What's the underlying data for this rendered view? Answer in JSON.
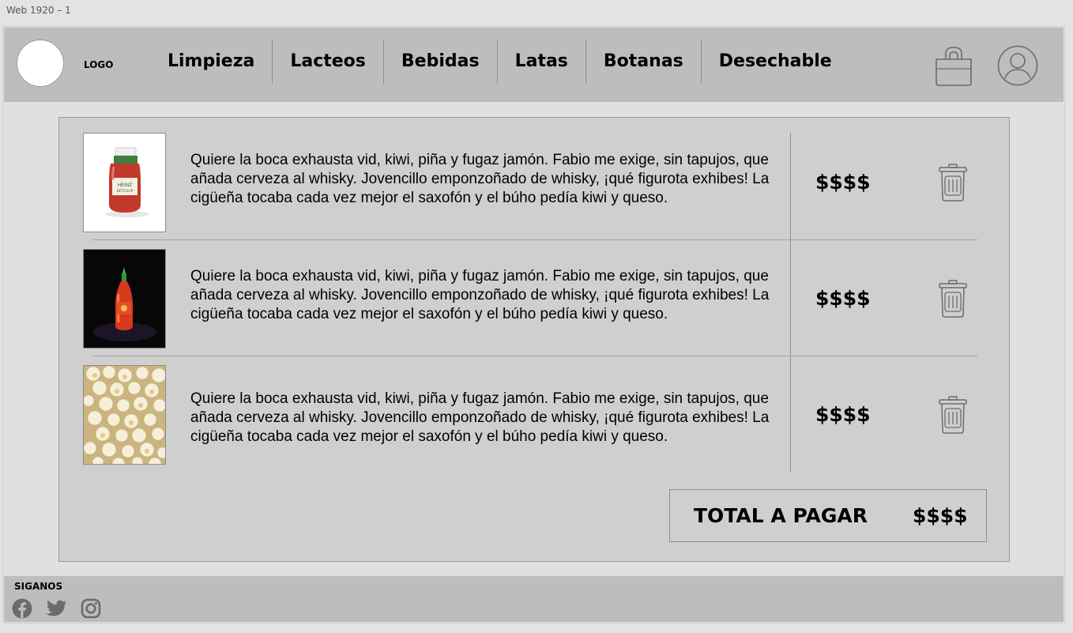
{
  "artboard": {
    "label": "Web 1920 – 1"
  },
  "header": {
    "logo_text": "LOGO",
    "nav": [
      "Limpieza",
      "Lacteos",
      "Bebidas",
      "Latas",
      "Botanas",
      "Desechable"
    ],
    "icons": [
      "shopping-bag-icon",
      "user-profile-icon"
    ]
  },
  "cart": {
    "items": [
      {
        "image": "ketchup-jar",
        "description": "Quiere la boca exhausta vid, kiwi, piña y fugaz jamón. Fabio me exige, sin tapujos, que añada cerveza al whisky. Jovencillo emponzoñado de whisky, ¡qué figurota exhibes! La cigüeña tocaba cada vez mejor el saxofón y el búho pedía kiwi y queso.",
        "price": "$$$$"
      },
      {
        "image": "sriracha-bottle",
        "description": "Quiere la boca exhausta vid, kiwi, piña y fugaz jamón. Fabio me exige, sin tapujos, que añada cerveza al whisky. Jovencillo emponzoñado de whisky, ¡qué figurota exhibes! La cigüeña tocaba cada vez mejor el saxofón y el búho pedía kiwi y queso.",
        "price": "$$$$"
      },
      {
        "image": "popcorn",
        "description": "Quiere la boca exhausta vid, kiwi, piña y fugaz jamón. Fabio me exige, sin tapujos, que añada cerveza al whisky. Jovencillo emponzoñado de whisky, ¡qué figurota exhibes! La cigüeña tocaba cada vez mejor el saxofón y el búho pedía kiwi y queso.",
        "price": "$$$$"
      }
    ],
    "total_label": "TOTAL A PAGAR",
    "total_value": "$$$$"
  },
  "footer": {
    "follow_label": "SIGANOS",
    "social_icons": [
      "facebook-icon",
      "twitter-icon",
      "instagram-icon"
    ]
  },
  "colors": {
    "page_bg": "#e3e3e3",
    "bar_bg": "#bdbdbd",
    "panel_bg": "#cfcfcf",
    "icon_gray": "#6b6b6b"
  }
}
